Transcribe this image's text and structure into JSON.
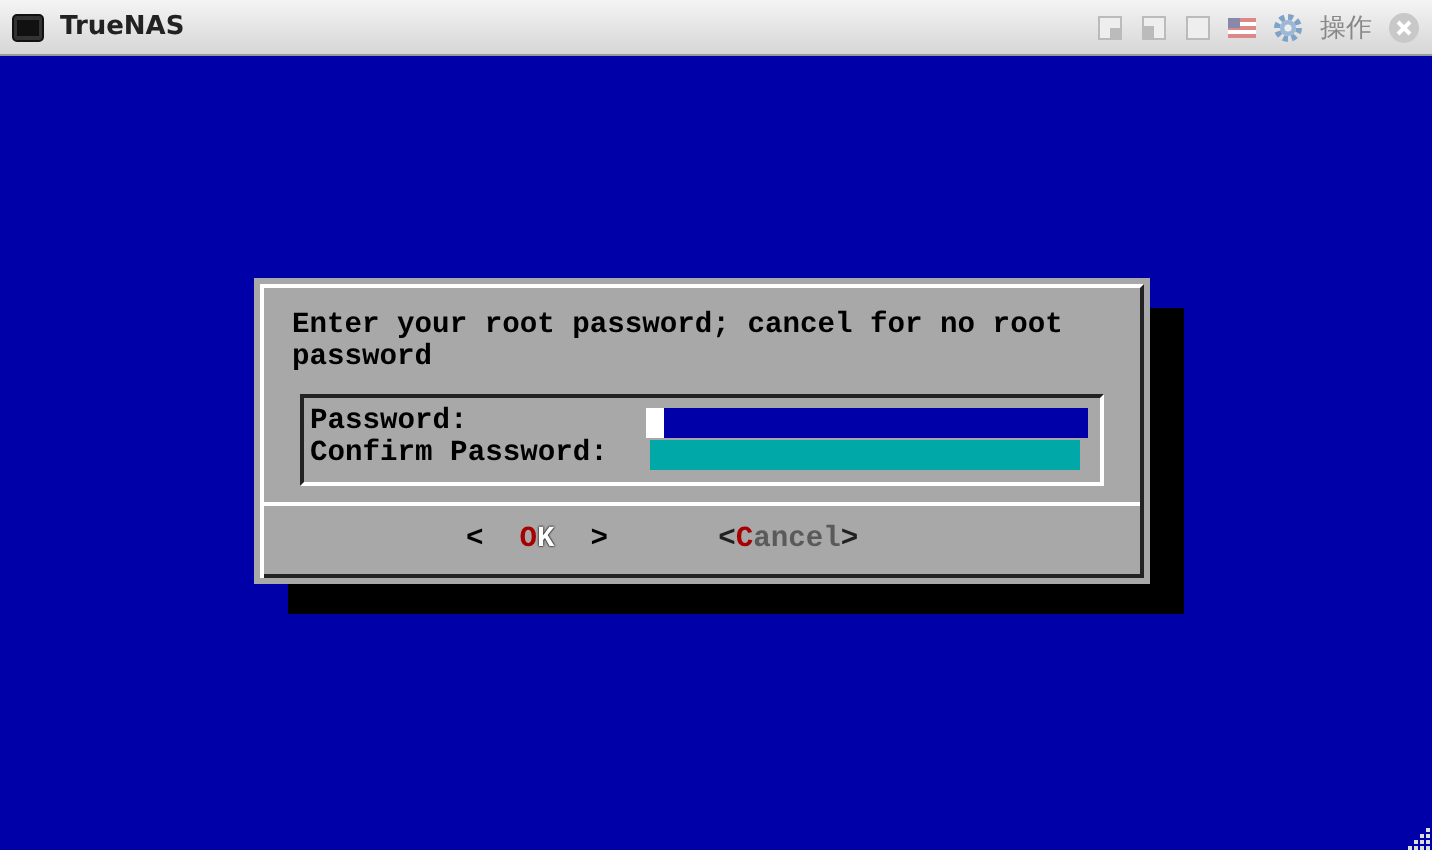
{
  "window": {
    "title": "TrueNAS",
    "menu_label": "操作"
  },
  "dialog": {
    "message": "Enter your root password; cancel for no root password",
    "fields": [
      {
        "label": "Password:",
        "focused": true
      },
      {
        "label": "Confirm Password:",
        "focused": false
      }
    ],
    "buttons": [
      {
        "left": "<",
        "label": "OK",
        "right": ">",
        "selected": true
      },
      {
        "left": "<",
        "label": "Cancel",
        "right": ">",
        "selected": false
      }
    ]
  }
}
